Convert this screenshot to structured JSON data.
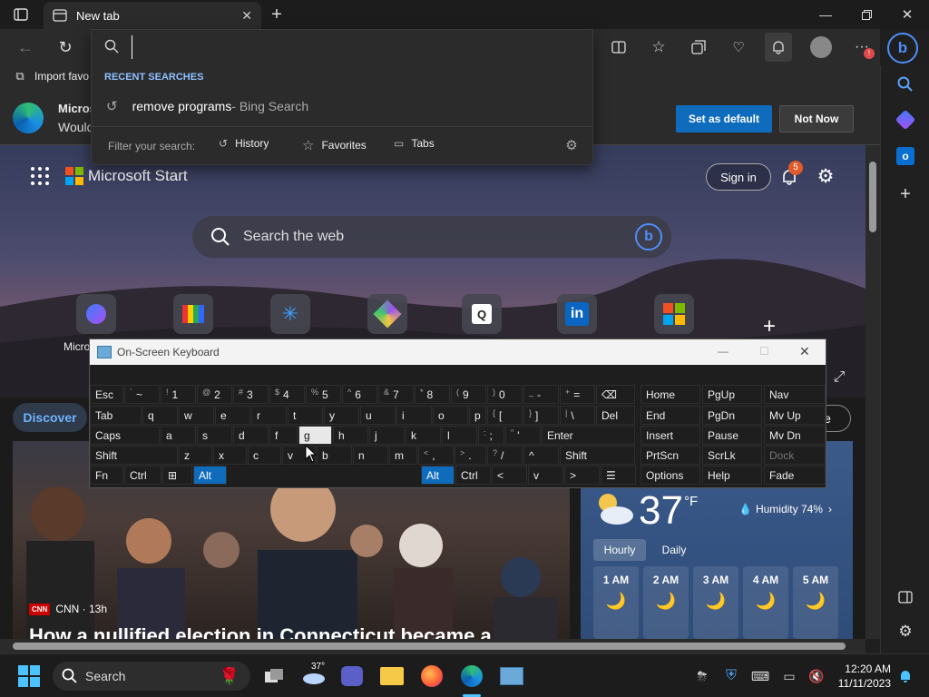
{
  "browser": {
    "tab_title": "New tab",
    "fav_item": "Import favo",
    "address_value": ""
  },
  "banner": {
    "title": "Micros",
    "text": "Would",
    "set_default": "Set as default",
    "not_now": "Not Now"
  },
  "dropdown": {
    "header": "RECENT SEARCHES",
    "recent": [
      {
        "query": "remove programs",
        "source": " - Bing Search"
      }
    ],
    "filter_label": "Filter your search:",
    "filters": [
      "History",
      "Favorites",
      "Tabs"
    ]
  },
  "start": {
    "brand": "Microsoft Start",
    "sign_in": "Sign in",
    "notif_count": "5",
    "search_placeholder": "Search the web",
    "tile_label": "Micro",
    "discover": "Discover",
    "personalize": "ize"
  },
  "news": {
    "source": "CNN · 13h",
    "headline": "How a nullified election in Connecticut became a"
  },
  "weather": {
    "temp": "37",
    "unit": "°F",
    "humidity": "Humidity 74%",
    "tabs": [
      "Hourly",
      "Daily"
    ],
    "hours": [
      "1 AM",
      "2 AM",
      "3 AM",
      "4 AM",
      "5 AM"
    ]
  },
  "osk": {
    "title": "On-Screen Keyboard",
    "rows": [
      [
        [
          "Esc",
          ""
        ],
        [
          "~",
          "`"
        ],
        [
          "1",
          "!"
        ],
        [
          "2",
          "@"
        ],
        [
          "3",
          "#"
        ],
        [
          "4",
          "$"
        ],
        [
          "5",
          "%"
        ],
        [
          "6",
          "^"
        ],
        [
          "7",
          "&"
        ],
        [
          "8",
          "*"
        ],
        [
          "9",
          "("
        ],
        [
          "0",
          ")"
        ],
        [
          "-",
          "_"
        ],
        [
          "=",
          "+"
        ],
        [
          "⌫",
          ""
        ]
      ],
      [
        [
          "Tab",
          ""
        ],
        [
          "q",
          ""
        ],
        [
          "w",
          ""
        ],
        [
          "e",
          ""
        ],
        [
          "r",
          ""
        ],
        [
          "t",
          ""
        ],
        [
          "y",
          ""
        ],
        [
          "u",
          ""
        ],
        [
          "i",
          ""
        ],
        [
          "o",
          ""
        ],
        [
          "p",
          ""
        ],
        [
          "[",
          "{"
        ],
        [
          "]",
          "}"
        ],
        [
          "\\",
          "|"
        ],
        [
          "Del",
          ""
        ]
      ],
      [
        [
          "Caps",
          ""
        ],
        [
          "a",
          ""
        ],
        [
          "s",
          ""
        ],
        [
          "d",
          ""
        ],
        [
          "f",
          ""
        ],
        [
          "g",
          ""
        ],
        [
          "h",
          ""
        ],
        [
          "j",
          ""
        ],
        [
          "k",
          ""
        ],
        [
          "l",
          ""
        ],
        [
          ";",
          ":"
        ],
        [
          "'",
          "\""
        ],
        [
          "Enter",
          ""
        ]
      ],
      [
        [
          "Shift",
          ""
        ],
        [
          "z",
          ""
        ],
        [
          "x",
          ""
        ],
        [
          "c",
          ""
        ],
        [
          "v",
          ""
        ],
        [
          "b",
          ""
        ],
        [
          "n",
          ""
        ],
        [
          "m",
          ""
        ],
        [
          ",",
          "<"
        ],
        [
          ".",
          ">"
        ],
        [
          "/",
          "?"
        ],
        [
          "^",
          ""
        ],
        [
          "Shift",
          ""
        ]
      ],
      [
        [
          "Fn",
          ""
        ],
        [
          "Ctrl",
          ""
        ],
        [
          "⊞",
          ""
        ],
        [
          "Alt",
          ""
        ],
        [
          "Alt",
          ""
        ],
        [
          "Ctrl",
          ""
        ],
        [
          "<",
          ""
        ],
        [
          "v",
          ""
        ],
        [
          ">",
          ""
        ],
        [
          "☰",
          ""
        ]
      ]
    ],
    "nav": [
      [
        "Home",
        "PgUp",
        "Nav"
      ],
      [
        "End",
        "PgDn",
        "Mv Up"
      ],
      [
        "Insert",
        "Pause",
        "Mv Dn"
      ],
      [
        "PrtScn",
        "ScrLk",
        "Dock"
      ],
      [
        "Options",
        "Help",
        "Fade"
      ]
    ]
  },
  "taskbar": {
    "search": "Search",
    "weather_temp": "37°",
    "time": "12:20 AM",
    "date": "11/11/2023"
  },
  "colors": {
    "accent": "#0f6cbd",
    "pressed": "#e8e8e8"
  }
}
